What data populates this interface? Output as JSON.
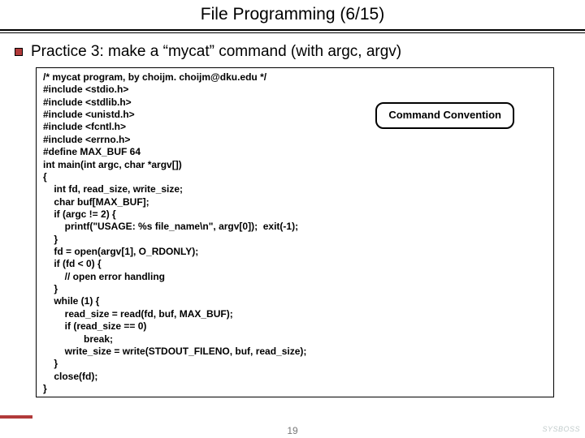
{
  "title": "File Programming (6/15)",
  "bullet": "Practice 3: make a “mycat” command (with argc, argv)",
  "callout": "Command Convention",
  "page_number": "19",
  "logo_text": "SYSBOSS",
  "code": {
    "l01": "/* mycat program, by choijm. choijm@dku.edu */",
    "l02": "#include <stdio.h>",
    "l03": "#include <stdlib.h>",
    "l04": "#include <unistd.h>",
    "l05": "#include <fcntl.h>",
    "l06": "#include <errno.h>",
    "l07": "#define MAX_BUF 64",
    "l08": "",
    "l09": "int main(int argc, char *argv[])",
    "l10": "{",
    "l11": "    int fd, read_size, write_size;",
    "l12": "    char buf[MAX_BUF];",
    "l13": "",
    "l14": "    if (argc != 2) {",
    "l15": "        printf(\"USAGE: %s file_name\\n\", argv[0]);  exit(-1);",
    "l16": "    }",
    "l17": "    fd = open(argv[1], O_RDONLY);",
    "l18": "    if (fd < 0) {",
    "l19": "        // open error handling",
    "l20": "    }",
    "l21": "    while (1) {",
    "l22": "        read_size = read(fd, buf, MAX_BUF);",
    "l23": "        if (read_size == 0)",
    "l24": "               break;",
    "l25": "        write_size = write(STDOUT_FILENO, buf, read_size);",
    "l26": "    }",
    "l27": "    close(fd);",
    "l28": "}"
  }
}
